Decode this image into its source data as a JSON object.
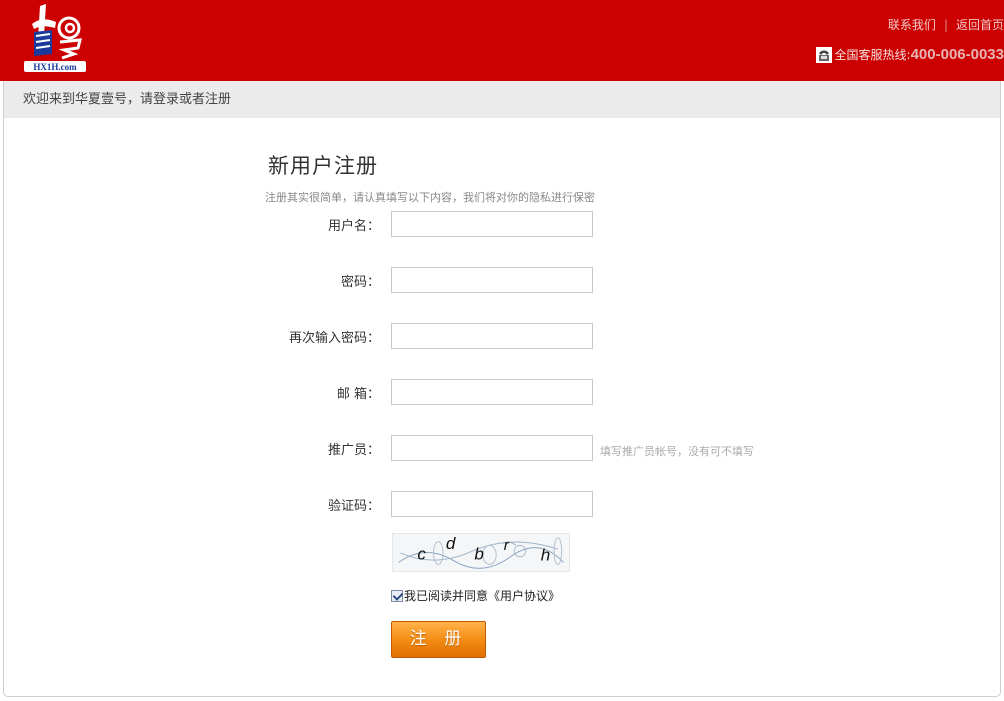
{
  "header": {
    "logo_text": "HX1H.com",
    "links": {
      "contact": "联系我们",
      "separator": "|",
      "home": "返回首页"
    },
    "hotline": {
      "label": "全国客服热线:",
      "number": "400-006-0033",
      "icon": "phone-icon"
    }
  },
  "welcome": "欢迎来到华夏壹号，请登录或者注册",
  "form": {
    "title": "新用户注册",
    "subtitle": "注册其实很简单，请认真填写以下内容，我们将对你的隐私进行保密",
    "fields": [
      {
        "label": "用户名：",
        "value": "",
        "placeholder": ""
      },
      {
        "label": "密码：",
        "value": "",
        "placeholder": ""
      },
      {
        "label": "再次输入密码：",
        "value": "",
        "placeholder": ""
      },
      {
        "label": "邮 箱：",
        "value": "",
        "placeholder": ""
      },
      {
        "label": "推广员：",
        "value": "",
        "placeholder": "",
        "hint": "填写推广员帐号，没有可不填写"
      },
      {
        "label": "验证码：",
        "value": "",
        "placeholder": ""
      }
    ],
    "captcha_text": "cdbrh",
    "agree": {
      "checked": true,
      "text": "我已阅读并同意",
      "link": "《用户协议》"
    },
    "submit_label": "注 册"
  },
  "colors": {
    "header_bg": "#cc0000",
    "button": "#f28a10",
    "welcome_bg": "#ebebeb"
  }
}
